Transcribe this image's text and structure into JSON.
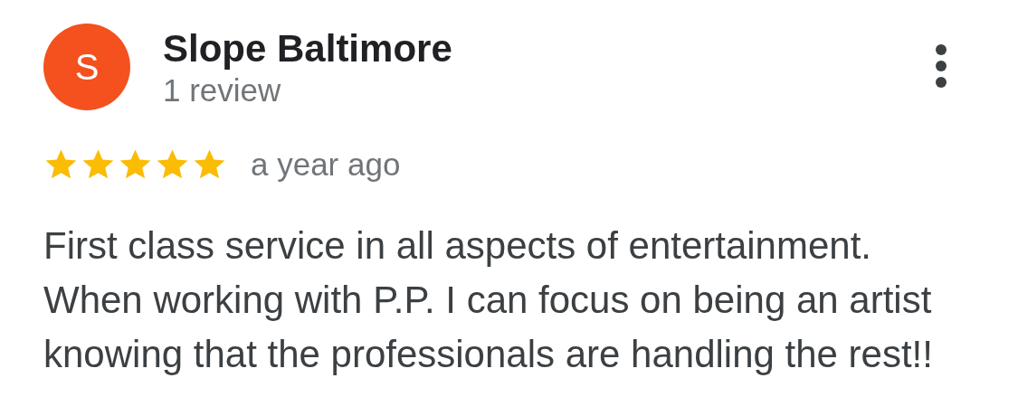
{
  "review": {
    "avatar_letter": "S",
    "author": "Slope Baltimore",
    "author_meta": "1 review",
    "stars": 5,
    "time": "a year ago",
    "text": "First class service in all aspects of entertainment. When working with P.P. I can focus on being an artist knowing that the professionals are handling the rest!!"
  }
}
